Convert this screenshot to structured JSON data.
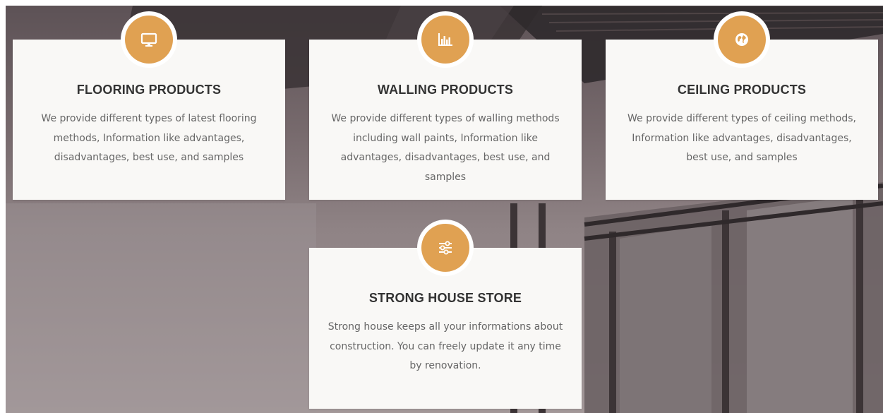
{
  "theme": {
    "accent": "#e0a152",
    "card_background": "#f9f8f6",
    "title_color": "#333333",
    "text_color": "#666666"
  },
  "features": [
    {
      "icon": "monitor-icon",
      "title": "FLOORING PRODUCTS",
      "description": "We provide different types of latest flooring methods, Information like advantages, disadvantages, best use, and samples"
    },
    {
      "icon": "bar-chart-icon",
      "title": "WALLING PRODUCTS",
      "description": "We provide different types of walling methods including wall paints, Information like advantages, disadvantages, best use, and samples"
    },
    {
      "icon": "globe-icon",
      "title": "CEILING PRODUCTS",
      "description": "We provide different types of ceiling methods, Information like advantages, disadvantages, best use, and samples"
    },
    {
      "icon": "sliders-icon",
      "title": "STRONG HOUSE STORE",
      "description": "Strong house keeps all your informations about construction. You can freely update it any time by renovation."
    }
  ]
}
